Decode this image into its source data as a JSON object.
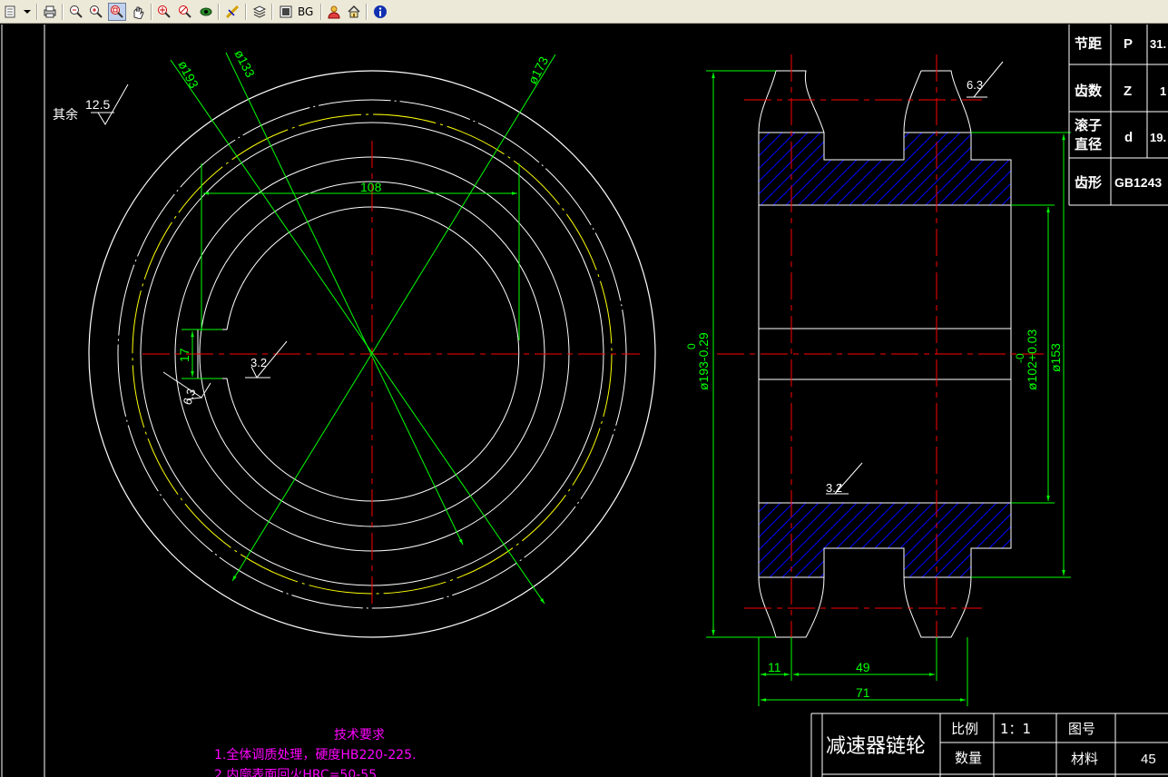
{
  "toolbar": {
    "bg_label": "BG"
  },
  "view": {
    "surface_roughness_default": {
      "prefix": "其余",
      "value": "12.5"
    },
    "dims_left": {
      "d193": "ø193",
      "d133": "ø133",
      "d173": "ø173",
      "w108": "108",
      "h17": "17",
      "r32": "3.2",
      "r63": "6.3"
    },
    "dims_right": {
      "r63_top": "6.3",
      "r32_bottom": "3.2",
      "outer_main": "ø193-0.29",
      "outer_tol": "0",
      "bore_main": "ø102+0.03",
      "bore_tol": "-0",
      "hub": "ø153",
      "w11": "11",
      "w49": "49",
      "w71": "71"
    }
  },
  "params_table": {
    "rows": [
      {
        "name": "节距",
        "symbol": "P",
        "value": "31."
      },
      {
        "name": "齿数",
        "symbol": "Z",
        "value": "1"
      },
      {
        "name": "滚子直径",
        "name_line1": "滚子",
        "name_line2": "直径",
        "symbol": "d",
        "value": "19."
      },
      {
        "name": "齿形",
        "symbol": "",
        "value": "GB1243"
      }
    ]
  },
  "notes": {
    "title": "技术要求",
    "lines": [
      "1.全体调质处理，硬度HB220-225.",
      "2.内廓表面回火HRC=50-55"
    ]
  },
  "title_block": {
    "part_name": "减速器链轮",
    "scale_label": "比例",
    "scale_value": "1：1",
    "drawing_no_label": "图号",
    "qty_label": "数量",
    "material_label": "材料",
    "material_value": "45"
  },
  "colors": {
    "background": "#000000",
    "outline": "#ffffff",
    "centerline": "#ff0000",
    "dimension": "#00ff00",
    "pitch_circle": "#ffff00",
    "hatch": "#0000ff",
    "notes": "#ff00ff"
  }
}
